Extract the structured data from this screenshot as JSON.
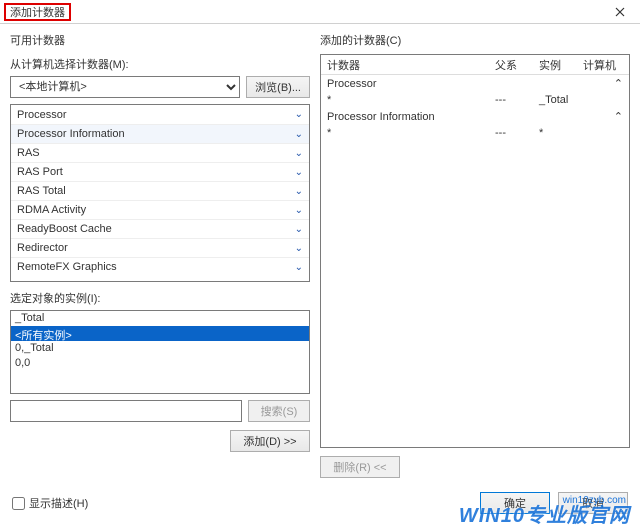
{
  "window": {
    "title": "添加计数器"
  },
  "left": {
    "label": "可用计数器",
    "from_label": "从计算机选择计数器(M):",
    "computer_value": "<本地计算机>",
    "browse_btn": "浏览(B)...",
    "counters": [
      "Processor",
      "Processor Information",
      "RAS",
      "RAS Port",
      "RAS Total",
      "RDMA Activity",
      "ReadyBoost Cache",
      "Redirector",
      "RemoteFX Graphics"
    ],
    "selected_counter_index": 1,
    "instances_label": "选定对象的实例(I):",
    "instances": [
      "_Total",
      "<所有实例>",
      "0,_Total",
      "0,0"
    ],
    "selected_instance_index": 1,
    "search_btn": "搜索(S)",
    "add_btn": "添加(D) >>"
  },
  "right": {
    "label": "添加的计数器(C)",
    "columns": [
      "计数器",
      "父系",
      "实例",
      "计算机"
    ],
    "groups": [
      {
        "name": "Processor",
        "rows": [
          {
            "counter": "*",
            "parent": "---",
            "instance": "_Total",
            "computer": ""
          }
        ]
      },
      {
        "name": "Processor Information",
        "rows": [
          {
            "counter": "*",
            "parent": "---",
            "instance": "*",
            "computer": ""
          }
        ]
      }
    ],
    "remove_btn": "删除(R) <<"
  },
  "footer": {
    "show_desc": "显示描述(H)",
    "ok": "确定",
    "cancel": "取消"
  },
  "watermark": {
    "url": "win10zyb.com",
    "text": "WIN10专业版官网"
  }
}
